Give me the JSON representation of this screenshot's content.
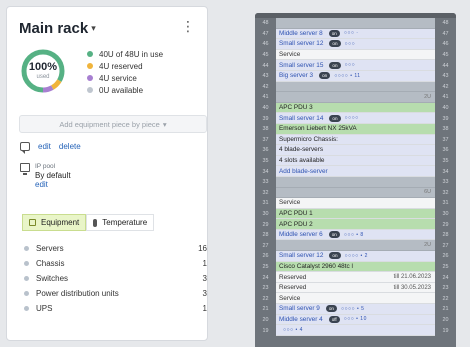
{
  "title": "Main rack",
  "usage": {
    "percent": "100%",
    "percent_label": "used",
    "legend": [
      {
        "text": "40U of 48U in use",
        "color": "#56b184"
      },
      {
        "text": "4U reserved",
        "color": "#f0b43c"
      },
      {
        "text": "4U service",
        "color": "#a77fd1"
      },
      {
        "text": "0U available",
        "color": "#bfc6cf"
      }
    ]
  },
  "add_button": "Add equipment piece by piece",
  "comment": {
    "edit": "edit",
    "delete": "delete"
  },
  "ip_pool": {
    "label": "IP pool",
    "value": "By default",
    "edit": "edit"
  },
  "tabs": [
    {
      "label": "Equipment"
    },
    {
      "label": "Temperature"
    }
  ],
  "equipment": [
    {
      "name": "Servers",
      "count": "16"
    },
    {
      "name": "Chassis",
      "count": "1"
    },
    {
      "name": "Switches",
      "count": "3"
    },
    {
      "name": "Power distribution units",
      "count": "3"
    },
    {
      "name": "UPS",
      "count": "1"
    }
  ],
  "rack": {
    "rows": [
      {
        "n": "48",
        "type": "empty",
        "text": ""
      },
      {
        "n": "47",
        "type": "srv",
        "text": "Middle server 8",
        "badge": "on",
        "ports": "○○○ ·"
      },
      {
        "n": "46",
        "type": "srv",
        "text": "Small server 12",
        "badge": "on",
        "ports": "○○○"
      },
      {
        "n": "45",
        "type": "svc",
        "text": "Service"
      },
      {
        "n": "44",
        "type": "srv",
        "text": "Small server 15",
        "badge": "on",
        "ports": "○○○"
      },
      {
        "n": "43",
        "type": "srv",
        "text": "Big server 3",
        "badge": "on",
        "ports": "○○○○ • 11"
      },
      {
        "n": "42",
        "type": "empty",
        "text": ""
      },
      {
        "n": "41",
        "type": "empty",
        "text": "",
        "u": "2U"
      },
      {
        "n": "40",
        "type": "pdu",
        "text": "APC PDU 3"
      },
      {
        "n": "39",
        "type": "srv",
        "text": "Small server 14",
        "badge": "on",
        "ports": "○○○○"
      },
      {
        "n": "38",
        "type": "pdu",
        "text": "Emerson Liebert NX 25kVA"
      },
      {
        "n": "37",
        "type": "chassis",
        "text": "Supermicro Chassis:"
      },
      {
        "n": "36",
        "type": "chassis",
        "text": "4 blade-servers"
      },
      {
        "n": "35",
        "type": "chassis",
        "text": "4 slots available"
      },
      {
        "n": "34",
        "type": "srv",
        "text": "Add blade-server"
      },
      {
        "n": "33",
        "type": "empty",
        "text": ""
      },
      {
        "n": "32",
        "type": "empty",
        "text": "",
        "u": "6U"
      },
      {
        "n": "31",
        "type": "svc",
        "text": "Service"
      },
      {
        "n": "30",
        "type": "pdu",
        "text": "APC PDU 1"
      },
      {
        "n": "29",
        "type": "pdu",
        "text": "APC PDU 2"
      },
      {
        "n": "28",
        "type": "srv",
        "text": "Middle server 6",
        "badge": "on",
        "ports": "○○○ • 8"
      },
      {
        "n": "27",
        "type": "empty",
        "text": "",
        "u": "2U"
      },
      {
        "n": "26",
        "type": "srv",
        "text": "Small server 12",
        "badge": "on",
        "ports": "○○○○ • 2"
      },
      {
        "n": "25",
        "type": "pdu",
        "text": "Cisco Catalyst 2960 48tc l"
      },
      {
        "n": "24",
        "type": "svc",
        "text": "Reserved",
        "tag": "till 21.06.2023"
      },
      {
        "n": "23",
        "type": "svc",
        "text": "Reserved",
        "tag": "till 30.05.2023"
      },
      {
        "n": "22",
        "type": "svc",
        "text": "Service"
      },
      {
        "n": "21",
        "type": "srv",
        "text": "Small server 9",
        "badge": "on",
        "ports": "○○○○ • 5"
      },
      {
        "n": "20",
        "type": "srv",
        "text": "Middle server 4",
        "badge": "off",
        "ports": "○○○ • 10"
      },
      {
        "n": "19",
        "type": "srv",
        "text": "",
        "ports": "○○○ • 4"
      }
    ]
  }
}
